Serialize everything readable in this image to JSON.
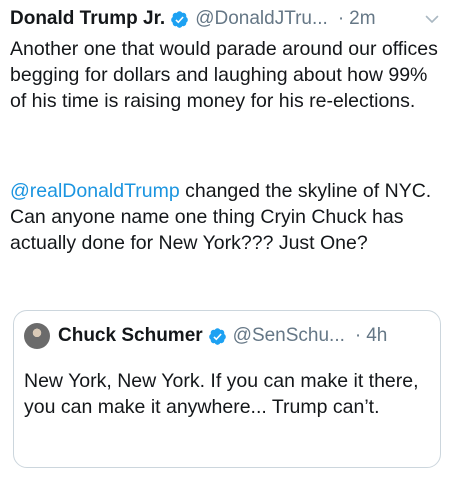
{
  "tweet": {
    "author_name": "Donald Trump Jr.",
    "handle": "@DonaldJTru...",
    "separator": "·",
    "time": "2m",
    "paragraph1": "Another one that would parade around our offices begging for dollars and laughing about how 99% of his time is raising money for his re-elections.",
    "mention": "@realDonaldTrump",
    "paragraph2_rest": " changed the skyline of NYC. Can anyone name one thing Cryin Chuck has actually done for New York??? Just One?",
    "verified_icon": "verified-badge-icon",
    "menu_icon": "chevron-down-icon"
  },
  "quoted_tweet": {
    "author_name": "Chuck Schumer",
    "handle": "@SenSchu...",
    "separator": "·",
    "time": "4h",
    "text": "New York, New York. If you can make it there, you can make it anywhere... Trump can’t."
  },
  "colors": {
    "text": "#14171a",
    "secondary": "#657786",
    "link": "#1b95e0",
    "verified": "#1da1f2",
    "border": "#ccd6dd"
  }
}
